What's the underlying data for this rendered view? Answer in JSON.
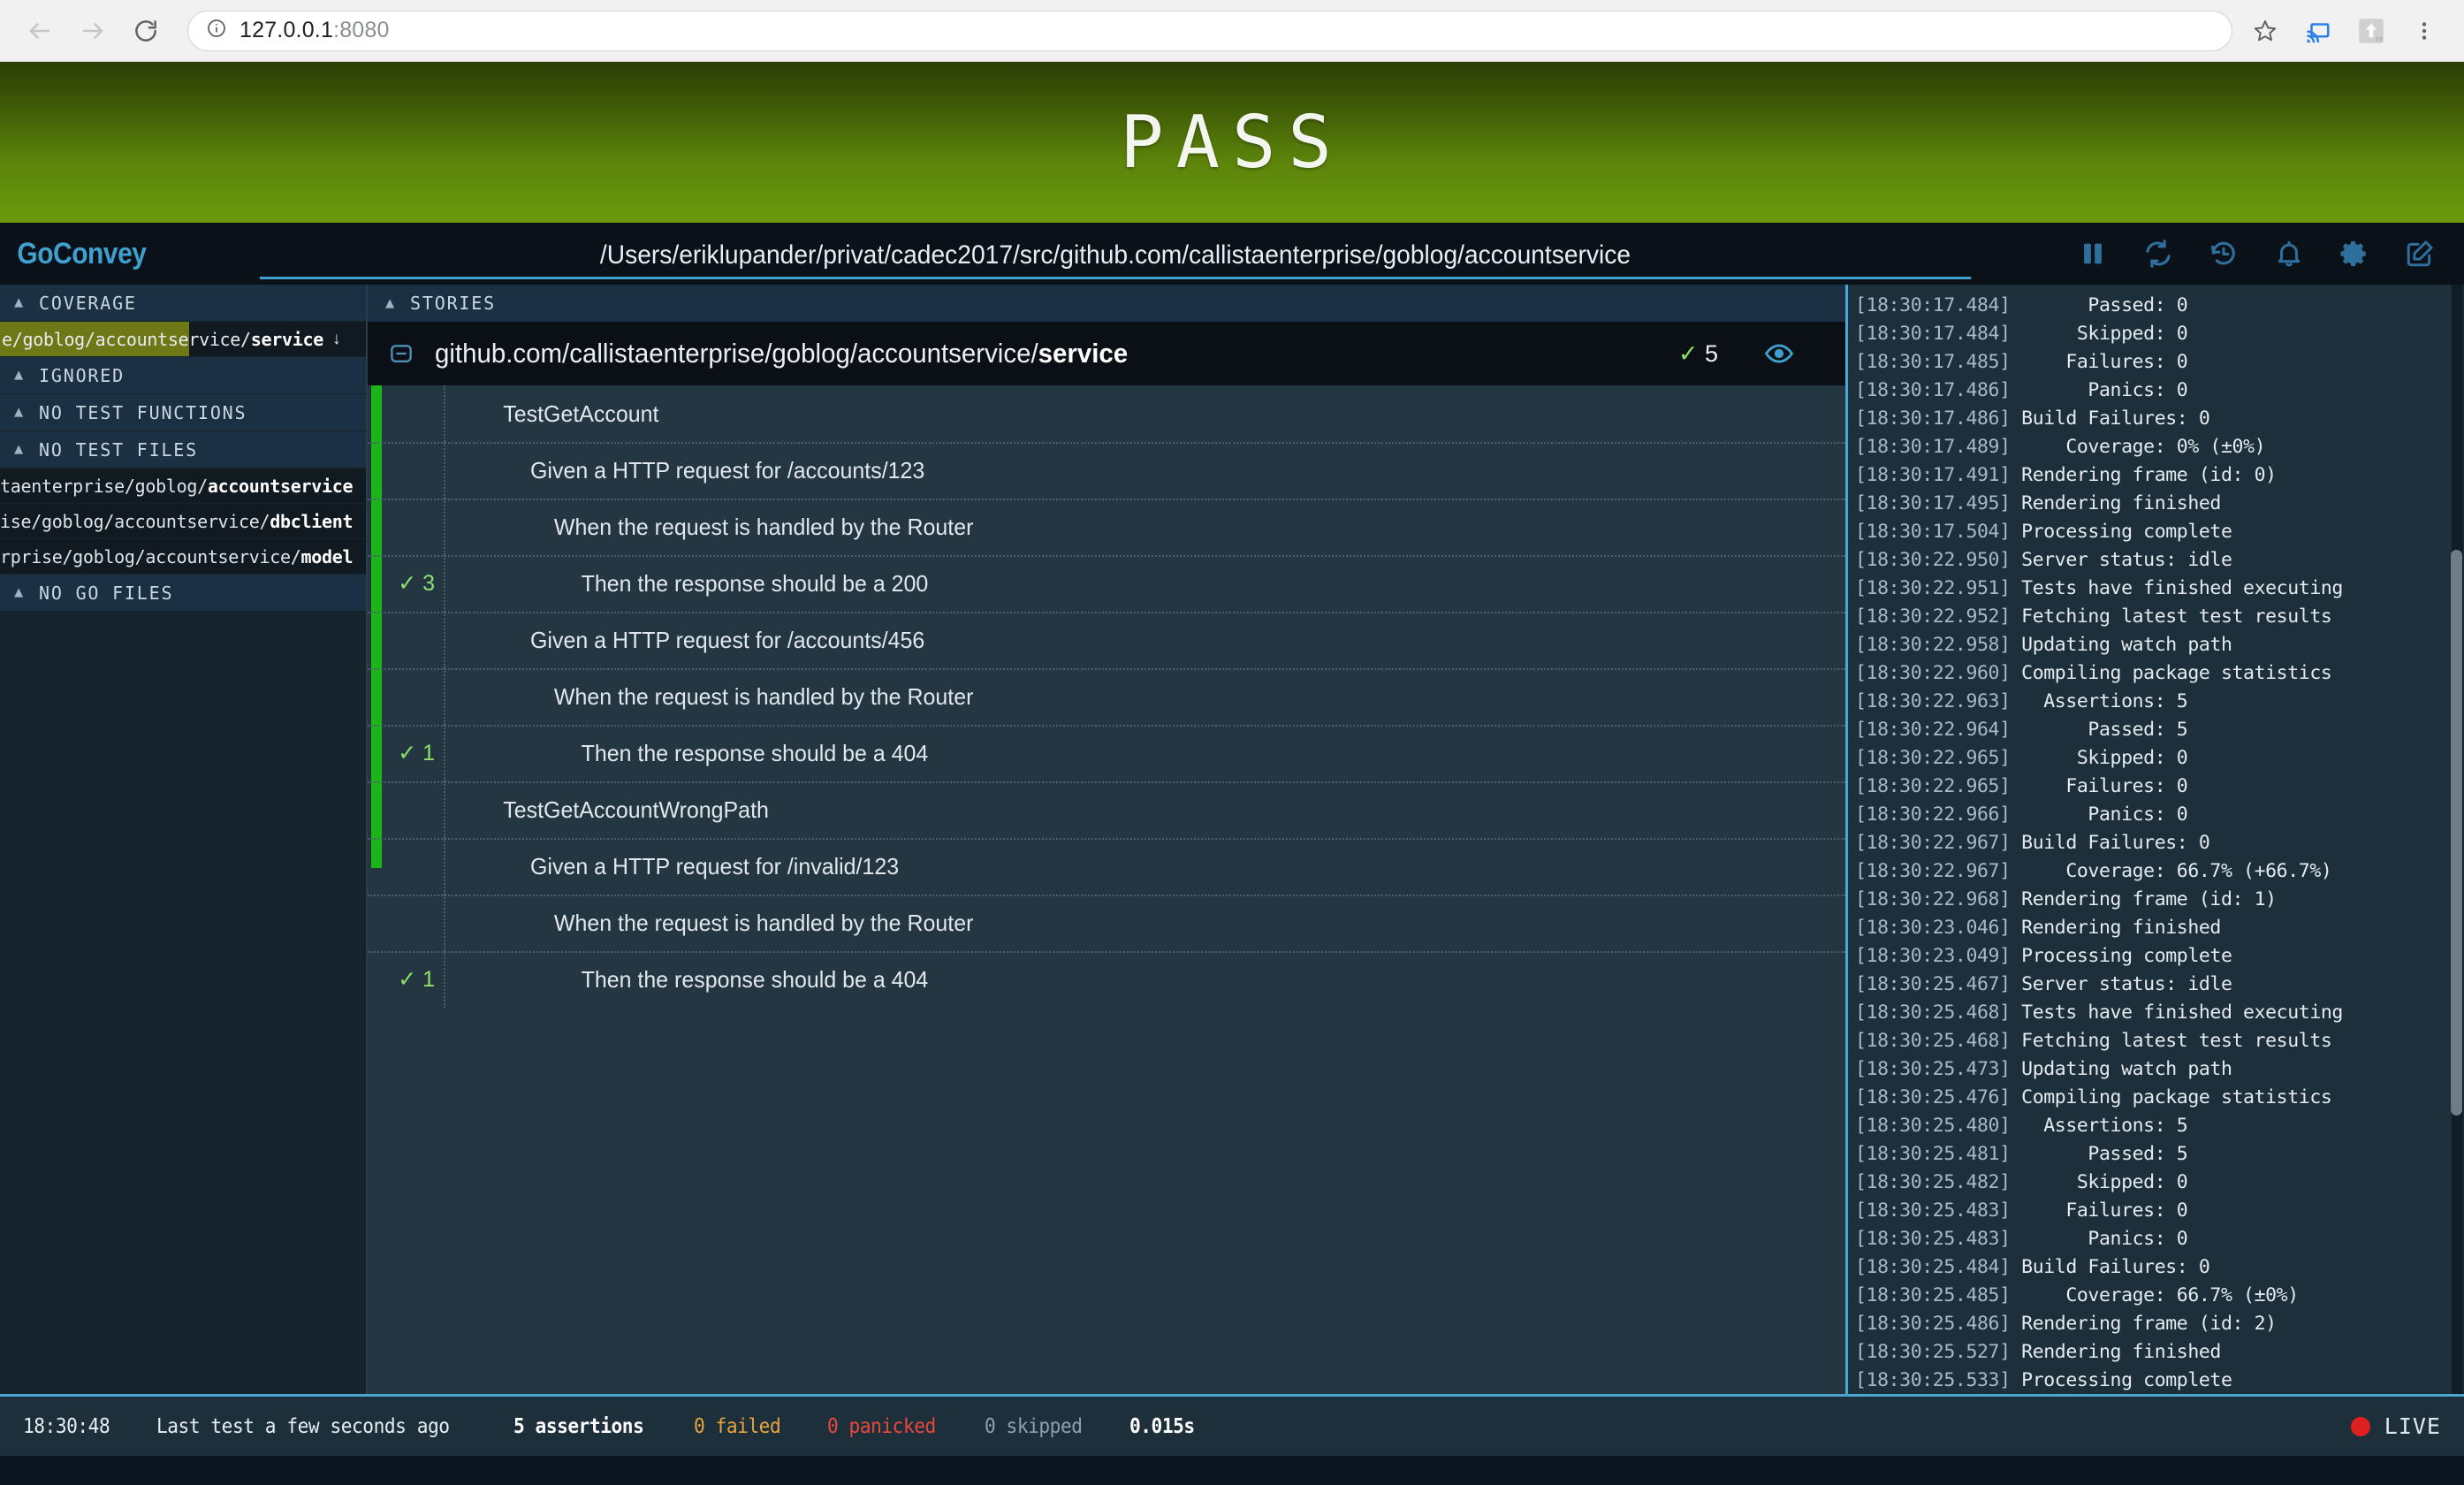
{
  "browser": {
    "back_icon": "back-arrow-icon",
    "forward_icon": "forward-arrow-icon",
    "reload_icon": "reload-icon",
    "site_info_icon": "info-circle-icon",
    "url_host": "127.0.0.1",
    "url_port": ":8080",
    "url_full": "127.0.0.1:8080",
    "bookmark_icon": "star-icon",
    "cast_icon": "cast-icon",
    "extension_icon": "extension-icon",
    "menu_icon": "three-dot-menu-icon",
    "accent_cast": "#2f7fe8"
  },
  "banner": {
    "status": "PASS",
    "color_top": "#2c3e06",
    "color_bottom": "#6a9a0c"
  },
  "header": {
    "logo": "GoConvey",
    "logo_color": "#3f9fce",
    "watch_path": "/Users/eriklupander/privat/cadec2017/src/github.com/callistaenterprise/goblog/accountservice",
    "actions": [
      {
        "name": "pause-button",
        "icon": "pause-icon"
      },
      {
        "name": "refresh-button",
        "icon": "refresh-icon"
      },
      {
        "name": "history-button",
        "icon": "history-icon"
      },
      {
        "name": "notifications-button",
        "icon": "bell-icon"
      },
      {
        "name": "settings-button",
        "icon": "gear-icon"
      },
      {
        "name": "compose-button",
        "icon": "edit-icon"
      }
    ]
  },
  "sidebar": {
    "sections": [
      {
        "label": "COVERAGE",
        "collapse_icon": "chevron-up-icon"
      },
      {
        "label": "IGNORED",
        "collapse_icon": "chevron-up-icon"
      },
      {
        "label": "NO TEST FUNCTIONS",
        "collapse_icon": "chevron-up-icon"
      },
      {
        "label": "NO TEST FILES",
        "collapse_icon": "chevron-up-icon"
      },
      {
        "label": "NO GO FILES",
        "collapse_icon": "chevron-up-icon"
      }
    ],
    "coverage": [
      {
        "path_prefix": "e/goblog/accountservice/",
        "path_name": "service",
        "percent": 66.7,
        "fill_color": "#6f7817",
        "sort_arrow": "↓"
      }
    ],
    "no_test_files": [
      {
        "path_prefix": "taenterprise/goblog/",
        "path_name": "accountservice"
      },
      {
        "path_prefix": "ise/goblog/accountservice/",
        "path_name": "dbclient"
      },
      {
        "path_prefix": "rprise/goblog/accountservice/",
        "path_name": "model"
      }
    ]
  },
  "stories": {
    "header_label": "STORIES",
    "collapse_icon": "minus-square-icon",
    "package_prefix": "github.com/callistaenterprise/goblog/accountservice/",
    "package_name": "service",
    "assertion_check": "✓",
    "assertion_count": "5",
    "watch_icon": "eye-icon",
    "pass_bar_color": "#19b519",
    "rows": [
      {
        "indent": 0,
        "text": "TestGetAccount",
        "count": "",
        "sep": false
      },
      {
        "indent": 1,
        "text": "Given a HTTP request for /accounts/123",
        "count": "",
        "sep": true
      },
      {
        "indent": 2,
        "text": "When the request is handled by the Router",
        "count": "",
        "sep": true
      },
      {
        "indent": 3,
        "text": "Then the response should be a 200",
        "count": "3",
        "sep": true
      },
      {
        "indent": 1,
        "text": "Given a HTTP request for /accounts/456",
        "count": "",
        "sep": true
      },
      {
        "indent": 2,
        "text": "When the request is handled by the Router",
        "count": "",
        "sep": true
      },
      {
        "indent": 3,
        "text": "Then the response should be a 404",
        "count": "1",
        "sep": true
      },
      {
        "indent": 0,
        "text": "TestGetAccountWrongPath",
        "count": "",
        "sep": true
      },
      {
        "indent": 1,
        "text": "Given a HTTP request for /invalid/123",
        "count": "",
        "sep": true
      },
      {
        "indent": 2,
        "text": "When the request is handled by the Router",
        "count": "",
        "sep": true
      },
      {
        "indent": 3,
        "text": "Then the response should be a 404",
        "count": "1",
        "sep": true
      }
    ]
  },
  "log": {
    "lines": [
      {
        "ts": "[18:30:17.484]",
        "msg": "       Passed: 0"
      },
      {
        "ts": "[18:30:17.484]",
        "msg": "      Skipped: 0"
      },
      {
        "ts": "[18:30:17.485]",
        "msg": "     Failures: 0"
      },
      {
        "ts": "[18:30:17.486]",
        "msg": "       Panics: 0"
      },
      {
        "ts": "[18:30:17.486]",
        "msg": " Build Failures: 0"
      },
      {
        "ts": "[18:30:17.489]",
        "msg": "     Coverage: 0% (±0%)"
      },
      {
        "ts": "[18:30:17.491]",
        "msg": " Rendering frame (id: 0)"
      },
      {
        "ts": "[18:30:17.495]",
        "msg": " Rendering finished"
      },
      {
        "ts": "[18:30:17.504]",
        "msg": " Processing complete"
      },
      {
        "ts": "[18:30:22.950]",
        "msg": " Server status: idle"
      },
      {
        "ts": "[18:30:22.951]",
        "msg": " Tests have finished executing"
      },
      {
        "ts": "[18:30:22.952]",
        "msg": " Fetching latest test results"
      },
      {
        "ts": "[18:30:22.958]",
        "msg": " Updating watch path"
      },
      {
        "ts": "[18:30:22.960]",
        "msg": " Compiling package statistics"
      },
      {
        "ts": "[18:30:22.963]",
        "msg": "   Assertions: 5"
      },
      {
        "ts": "[18:30:22.964]",
        "msg": "       Passed: 5"
      },
      {
        "ts": "[18:30:22.965]",
        "msg": "      Skipped: 0"
      },
      {
        "ts": "[18:30:22.965]",
        "msg": "     Failures: 0"
      },
      {
        "ts": "[18:30:22.966]",
        "msg": "       Panics: 0"
      },
      {
        "ts": "[18:30:22.967]",
        "msg": " Build Failures: 0"
      },
      {
        "ts": "[18:30:22.967]",
        "msg": "     Coverage: 66.7% (+66.7%)"
      },
      {
        "ts": "[18:30:22.968]",
        "msg": " Rendering frame (id: 1)"
      },
      {
        "ts": "[18:30:23.046]",
        "msg": " Rendering finished"
      },
      {
        "ts": "[18:30:23.049]",
        "msg": " Processing complete"
      },
      {
        "ts": "[18:30:25.467]",
        "msg": " Server status: idle"
      },
      {
        "ts": "[18:30:25.468]",
        "msg": " Tests have finished executing"
      },
      {
        "ts": "[18:30:25.468]",
        "msg": " Fetching latest test results"
      },
      {
        "ts": "[18:30:25.473]",
        "msg": " Updating watch path"
      },
      {
        "ts": "[18:30:25.476]",
        "msg": " Compiling package statistics"
      },
      {
        "ts": "[18:30:25.480]",
        "msg": "   Assertions: 5"
      },
      {
        "ts": "[18:30:25.481]",
        "msg": "       Passed: 5"
      },
      {
        "ts": "[18:30:25.482]",
        "msg": "      Skipped: 0"
      },
      {
        "ts": "[18:30:25.483]",
        "msg": "     Failures: 0"
      },
      {
        "ts": "[18:30:25.483]",
        "msg": "       Panics: 0"
      },
      {
        "ts": "[18:30:25.484]",
        "msg": " Build Failures: 0"
      },
      {
        "ts": "[18:30:25.485]",
        "msg": "     Coverage: 66.7% (±0%)"
      },
      {
        "ts": "[18:30:25.486]",
        "msg": " Rendering frame (id: 2)"
      },
      {
        "ts": "[18:30:25.527]",
        "msg": " Rendering finished"
      },
      {
        "ts": "[18:30:25.533]",
        "msg": " Processing complete"
      }
    ]
  },
  "status_bar": {
    "time": "18:30:48",
    "last_test": "Last test a few seconds ago",
    "assertions": "5 assertions",
    "failed": "0 failed",
    "panicked": "0 panicked",
    "skipped": "0 skipped",
    "duration": "0.015s",
    "live_label": "LIVE",
    "live_dot_color": "#e02020"
  }
}
